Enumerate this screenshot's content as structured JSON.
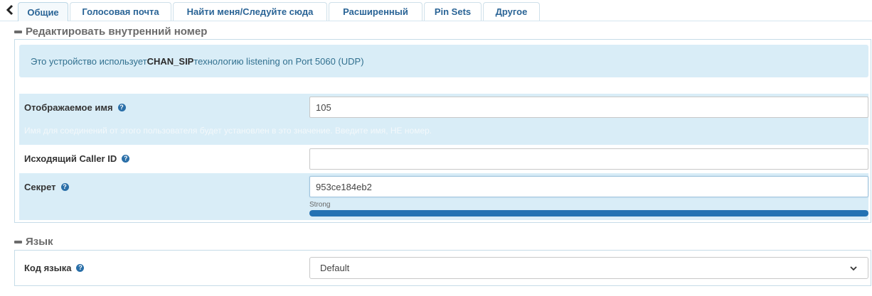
{
  "tabs": [
    {
      "label": "Общие",
      "active": true
    },
    {
      "label": "Голосовая почта"
    },
    {
      "label": "Найти меня/Следуйте сюда"
    },
    {
      "label": "Расширенный"
    },
    {
      "label": "Pin Sets"
    },
    {
      "label": "Другое"
    }
  ],
  "section_edit": {
    "title": "Редактировать внутренний номер"
  },
  "info": {
    "prefix": "Это устройство использует ",
    "tech": "CHAN_SIP",
    "suffix": " технологию listening on Port 5060 (UDP)"
  },
  "fields": {
    "display_name": {
      "label": "Отображаемое имя",
      "value": "105",
      "hint": "Имя для соединений от этого пользователя будет установлен в это значение. Введите имя, НЕ номер."
    },
    "outbound_cid": {
      "label": "Исходящий Caller ID",
      "value": ""
    },
    "secret": {
      "label": "Секрет",
      "value": "953ce184eb2",
      "strength_label": "Strong",
      "strength": 1.0
    }
  },
  "section_language": {
    "title": "Язык"
  },
  "language": {
    "label": "Код языка",
    "selected": "Default"
  },
  "colors": {
    "accent": "#2a6496",
    "info_bg": "#d9edf7",
    "strength": "#2472b3"
  },
  "icons": {
    "back": "chevron-left-icon",
    "collapse": "minus-icon",
    "help": "question-circle-icon",
    "select": "chevron-down-icon"
  }
}
